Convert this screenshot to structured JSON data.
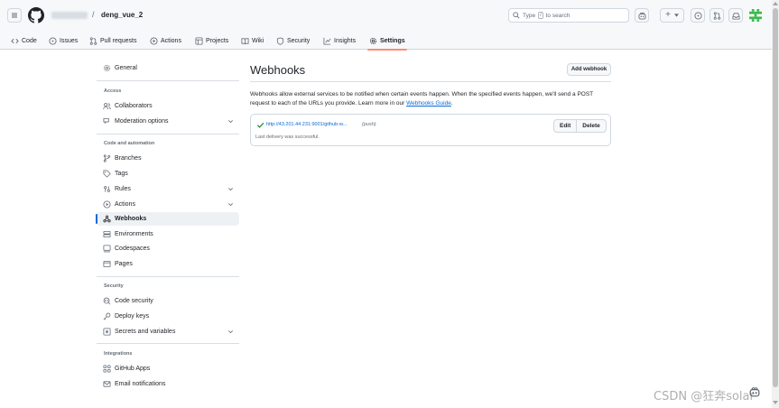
{
  "header": {
    "repo_separator": "/",
    "repo_name": "deng_vue_2",
    "search_prefix": "Type",
    "search_key": "/",
    "search_suffix": "to search",
    "plus_label": "+"
  },
  "tabs": [
    {
      "label": "Code",
      "icon": "code-icon"
    },
    {
      "label": "Issues",
      "icon": "issue-icon"
    },
    {
      "label": "Pull requests",
      "icon": "pull-request-icon"
    },
    {
      "label": "Actions",
      "icon": "play-icon"
    },
    {
      "label": "Projects",
      "icon": "table-icon"
    },
    {
      "label": "Wiki",
      "icon": "book-icon"
    },
    {
      "label": "Security",
      "icon": "shield-icon"
    },
    {
      "label": "Insights",
      "icon": "graph-icon"
    },
    {
      "label": "Settings",
      "icon": "gear-icon",
      "active": true
    }
  ],
  "sidebar": {
    "general": "General",
    "access_heading": "Access",
    "access": [
      "Collaborators",
      "Moderation options"
    ],
    "code_heading": "Code and automation",
    "code": [
      "Branches",
      "Tags",
      "Rules",
      "Actions",
      "Webhooks",
      "Environments",
      "Codespaces",
      "Pages"
    ],
    "security_heading": "Security",
    "security": [
      "Code security",
      "Deploy keys",
      "Secrets and variables"
    ],
    "integrations_heading": "Integrations",
    "integrations": [
      "GitHub Apps",
      "Email notifications"
    ],
    "active_item": "Webhooks"
  },
  "main": {
    "title": "Webhooks",
    "add_button": "Add webhook",
    "description": "Webhooks allow external services to be notified when certain events happen. When the specified events happen, we'll send a POST request to each of the URLs you provide. Learn more in our",
    "guide_link": "Webhooks Guide",
    "guide_suffix": ".",
    "webhook": {
      "url": "http://43.201.44.231:9001/github-w...",
      "event": "(push)",
      "status": "Last delivery was successful.",
      "edit": "Edit",
      "delete": "Delete"
    }
  },
  "watermark": "CSDN @狂奔solar",
  "colors": {
    "accent": "#0969da",
    "tab_underline": "#fd8c73",
    "success": "#1a7f37"
  }
}
